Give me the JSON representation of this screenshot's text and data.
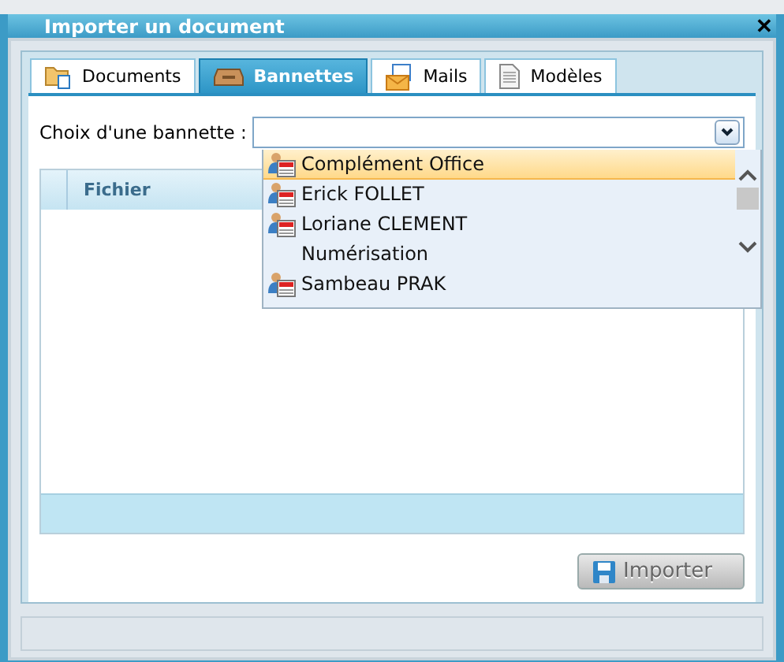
{
  "window": {
    "title": "Importer un document",
    "close": "✕"
  },
  "tabs": [
    {
      "label": "Documents",
      "selected": false,
      "kind": "folder"
    },
    {
      "label": "Bannettes",
      "selected": true,
      "kind": "tray"
    },
    {
      "label": "Mails",
      "selected": false,
      "kind": "mail"
    },
    {
      "label": "Modèles",
      "selected": false,
      "kind": "page"
    }
  ],
  "choice": {
    "label": "Choix d'une bannette :",
    "expanded": true,
    "options": [
      {
        "label": "Complément Office",
        "kind": "user",
        "selected": true
      },
      {
        "label": "Erick FOLLET",
        "kind": "user",
        "selected": false
      },
      {
        "label": "Loriane CLEMENT",
        "kind": "user",
        "selected": false
      },
      {
        "label": "Numérisation",
        "kind": "plain",
        "selected": false
      },
      {
        "label": "Sambeau PRAK",
        "kind": "user",
        "selected": false
      }
    ]
  },
  "table": {
    "columns": [
      "Fichier"
    ]
  },
  "import_button": {
    "label": "Importer",
    "disabled": true
  }
}
